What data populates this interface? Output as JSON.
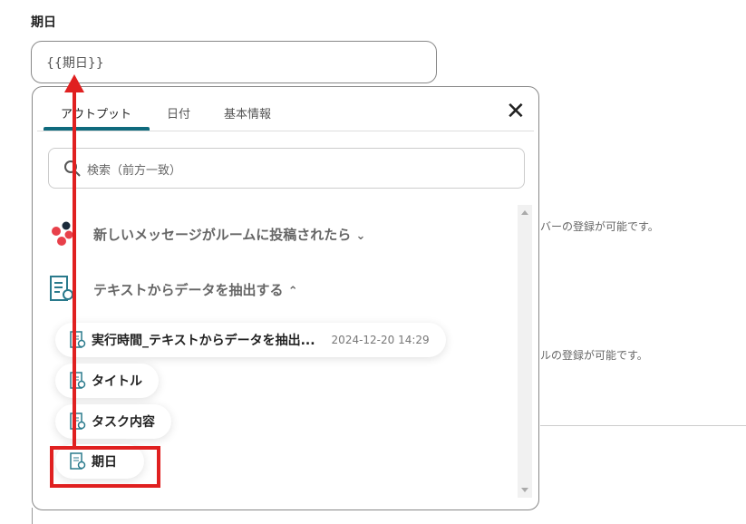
{
  "field": {
    "label": "期日",
    "value": "{{期日}}"
  },
  "background_texts": [
    "バーの登録が可能です。",
    "ルの登録が可能です。"
  ],
  "popup": {
    "tabs": [
      {
        "label": "アウトプット",
        "active": true
      },
      {
        "label": "日付"
      },
      {
        "label": "基本情報"
      }
    ],
    "search_placeholder": "検索（前方一致）",
    "groups": [
      {
        "title": "新しいメッセージがルームに投稿されたら",
        "expanded": false
      },
      {
        "title": "テキストからデータを抽出する",
        "expanded": true,
        "items": [
          {
            "label": "実行時間_テキストからデータを抽出...",
            "value": "2024-12-20 14:29"
          },
          {
            "label": "タイトル"
          },
          {
            "label": "タスク内容"
          },
          {
            "label": "期日",
            "highlighted": true
          }
        ]
      }
    ]
  },
  "colors": {
    "accent": "#0f6a7d",
    "annotation": "#e02020"
  }
}
